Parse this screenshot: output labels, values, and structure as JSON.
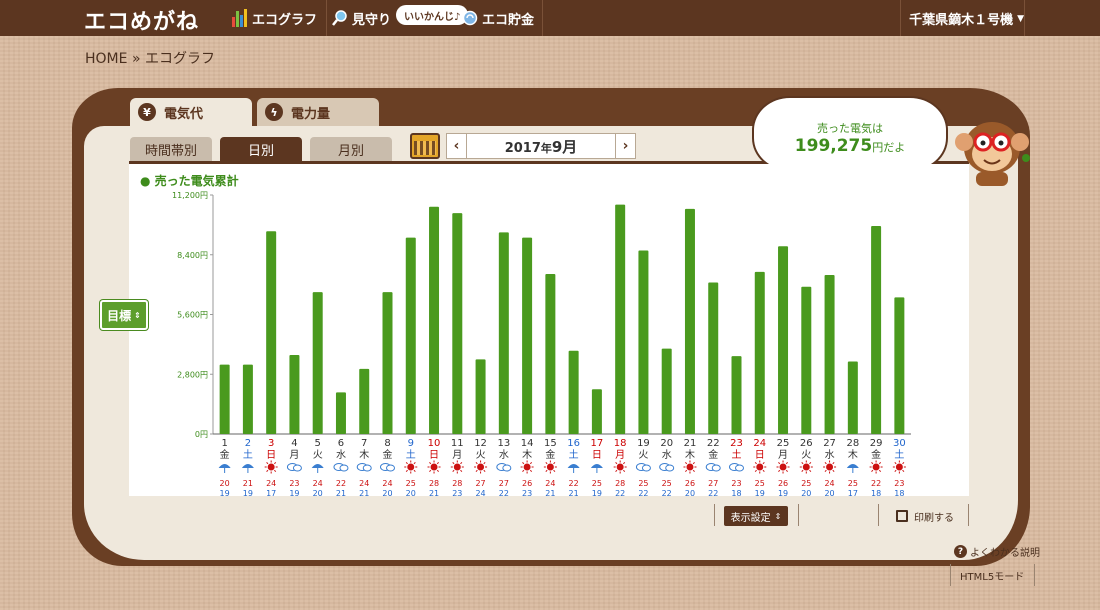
{
  "app": {
    "logo": "エコめがね",
    "nav": [
      {
        "label": "エコグラフ",
        "icon": "bar-graph-icon"
      },
      {
        "label": "見守り",
        "icon": "magnifier-icon"
      },
      {
        "label": "エコ貯金",
        "icon": "coin-icon"
      }
    ],
    "nav_bubble": "いいかんじ♪",
    "user_device": "千葉県鏑木１号機"
  },
  "breadcrumb": {
    "home": "HOME",
    "separator": "»",
    "current": "エコグラフ"
  },
  "tabs": {
    "main": [
      {
        "label": "電気代",
        "icon": "yen-icon",
        "active": true
      },
      {
        "label": "電力量",
        "icon": "lightning-icon",
        "active": false
      }
    ],
    "sub": [
      {
        "label": "時間帯別",
        "active": false
      },
      {
        "label": "日別",
        "active": true
      },
      {
        "label": "月別",
        "active": false
      }
    ]
  },
  "date_nav": {
    "prev": "‹",
    "next": "›",
    "year": "2017",
    "year_suffix": "年",
    "month": "9月"
  },
  "speech": {
    "line1": "売った電気は",
    "amount": "199,275",
    "suffix": "円だよ"
  },
  "goal_button": "目標",
  "controls": {
    "display_settings": "表示設定",
    "print": "印刷する"
  },
  "footer": {
    "help": "よくわかる説明",
    "html5": "HTML5モード"
  },
  "colors": {
    "brown": "#5c3620",
    "green_bar": "#4a9a1e",
    "holiday_red": "#cc0000",
    "saturday_blue": "#2266cc",
    "sun": "#cc0000"
  },
  "chart_data": {
    "type": "bar",
    "title": "売った電気累計",
    "ylim": [
      0,
      11200
    ],
    "yticks": [
      0,
      2800,
      5600,
      8400,
      11200
    ],
    "ytick_labels": [
      "0円",
      "2,800円",
      "5,600円",
      "8,400円",
      "11,200円"
    ],
    "categories": [
      "1",
      "2",
      "3",
      "4",
      "5",
      "6",
      "7",
      "8",
      "9",
      "10",
      "11",
      "12",
      "13",
      "14",
      "15",
      "16",
      "17",
      "18",
      "19",
      "20",
      "21",
      "22",
      "23",
      "24",
      "25",
      "26",
      "27",
      "28",
      "29",
      "30"
    ],
    "weekdays": [
      "金",
      "土",
      "日",
      "月",
      "火",
      "水",
      "木",
      "金",
      "土",
      "日",
      "月",
      "火",
      "水",
      "木",
      "金",
      "土",
      "日",
      "月",
      "火",
      "水",
      "木",
      "金",
      "土",
      "日",
      "月",
      "火",
      "水",
      "木",
      "金",
      "土"
    ],
    "day_type": [
      "w",
      "sat",
      "hol",
      "w",
      "w",
      "w",
      "w",
      "w",
      "sat",
      "hol",
      "w",
      "w",
      "w",
      "w",
      "w",
      "sat",
      "hol",
      "hol",
      "w",
      "w",
      "w",
      "w",
      "hol",
      "hol",
      "w",
      "w",
      "w",
      "w",
      "w",
      "sat"
    ],
    "weather": [
      "rain",
      "rain",
      "sun",
      "cloud",
      "rain",
      "cloud",
      "cloud",
      "cloud",
      "sun",
      "sun",
      "sun",
      "sun",
      "cloud",
      "sun",
      "sun",
      "rain",
      "rain",
      "sun",
      "cloud",
      "cloud",
      "sun",
      "cloud",
      "cloud",
      "sun",
      "sun",
      "sun",
      "sun",
      "rain",
      "sun",
      "sun"
    ],
    "values": [
      3250,
      3250,
      9500,
      3700,
      6650,
      1950,
      3050,
      6650,
      9200,
      10650,
      10350,
      3500,
      9450,
      9200,
      7500,
      3900,
      2100,
      10750,
      8600,
      4000,
      10550,
      7100,
      3650,
      7600,
      8800,
      6900,
      7450,
      3400,
      9750,
      6400
    ],
    "temp_high": [
      "20",
      "21",
      "24",
      "23",
      "24",
      "22",
      "24",
      "24",
      "25",
      "28",
      "28",
      "27",
      "27",
      "26",
      "24",
      "22",
      "25",
      "28",
      "25",
      "25",
      "26",
      "27",
      "23",
      "25",
      "26",
      "25",
      "24",
      "25",
      "22",
      "23"
    ],
    "temp_low": [
      "19",
      "19",
      "17",
      "19",
      "20",
      "21",
      "21",
      "20",
      "20",
      "21",
      "23",
      "24",
      "22",
      "23",
      "21",
      "21",
      "19",
      "22",
      "22",
      "22",
      "20",
      "22",
      "18",
      "19",
      "19",
      "20",
      "20",
      "17",
      "18",
      "18"
    ]
  }
}
